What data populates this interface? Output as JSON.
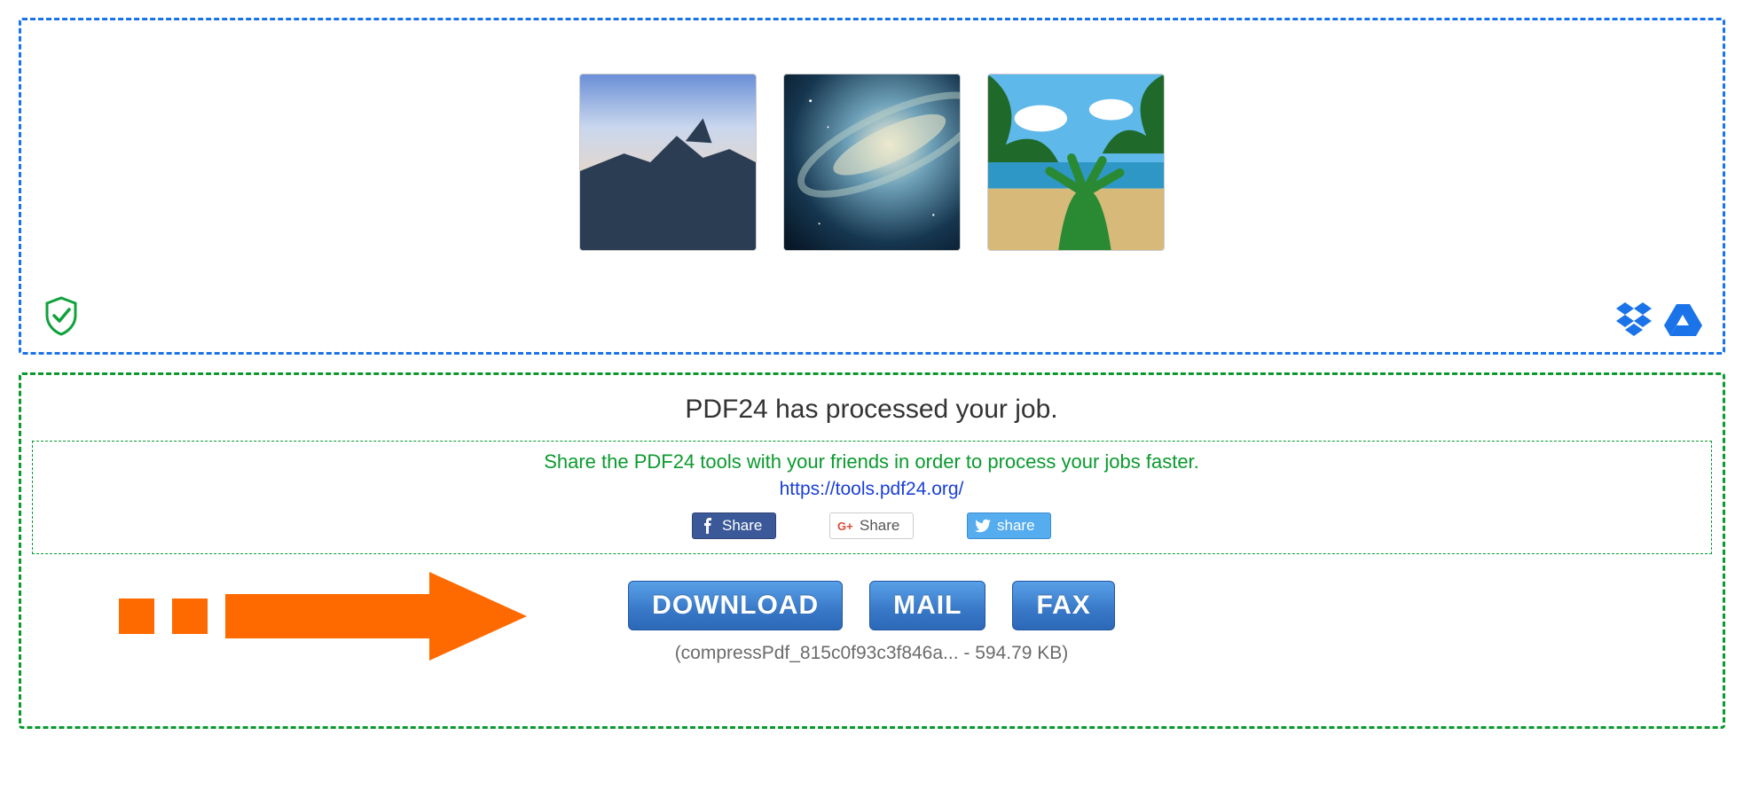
{
  "upload": {
    "thumbnails": [
      "image-coast",
      "image-galaxy",
      "image-beach"
    ]
  },
  "result": {
    "status_message": "PDF24 has processed your job.",
    "share_prompt": "Share the PDF24 tools with your friends in order to process your jobs faster.",
    "share_url": "https://tools.pdf24.org/",
    "share_buttons": {
      "facebook": "Share",
      "google_plus": "Share",
      "twitter": "share"
    },
    "actions": {
      "download": "DOWNLOAD",
      "mail": "MAIL",
      "fax": "FAX"
    },
    "file_info": "(compressPdf_815c0f93c3f846a... - 594.79 KB)"
  }
}
